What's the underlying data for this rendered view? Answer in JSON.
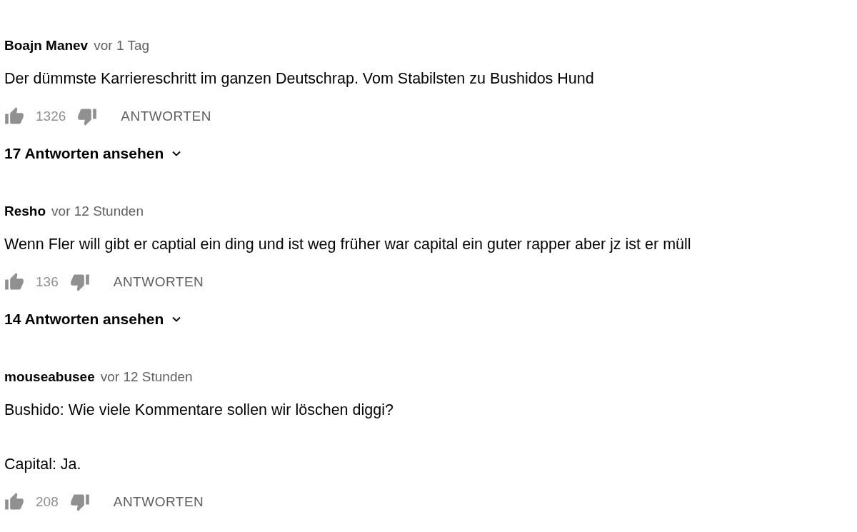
{
  "comments": [
    {
      "author": "Boajn Manev",
      "time": "vor 1 Tag",
      "paragraphs": [
        "Der dümmste Karriereschritt im ganzen Deutschrap. Vom Stabilsten zu Bushidos Hund"
      ],
      "likes": "1326",
      "reply_button": "ANTWORTEN",
      "replies_label": "17 Antworten ansehen"
    },
    {
      "author": "Resho",
      "time": "vor 12 Stunden",
      "paragraphs": [
        "Wenn Fler will gibt er captial ein ding und ist weg früher war capital ein guter rapper aber jz ist er müll"
      ],
      "likes": "136",
      "reply_button": "ANTWORTEN",
      "replies_label": "14 Antworten ansehen"
    },
    {
      "author": "mouseabusee",
      "time": "vor 12 Stunden",
      "paragraphs": [
        "Bushido: Wie viele Kommentare sollen wir löschen diggi?",
        "Capital: Ja."
      ],
      "likes": "208",
      "reply_button": "ANTWORTEN"
    }
  ]
}
